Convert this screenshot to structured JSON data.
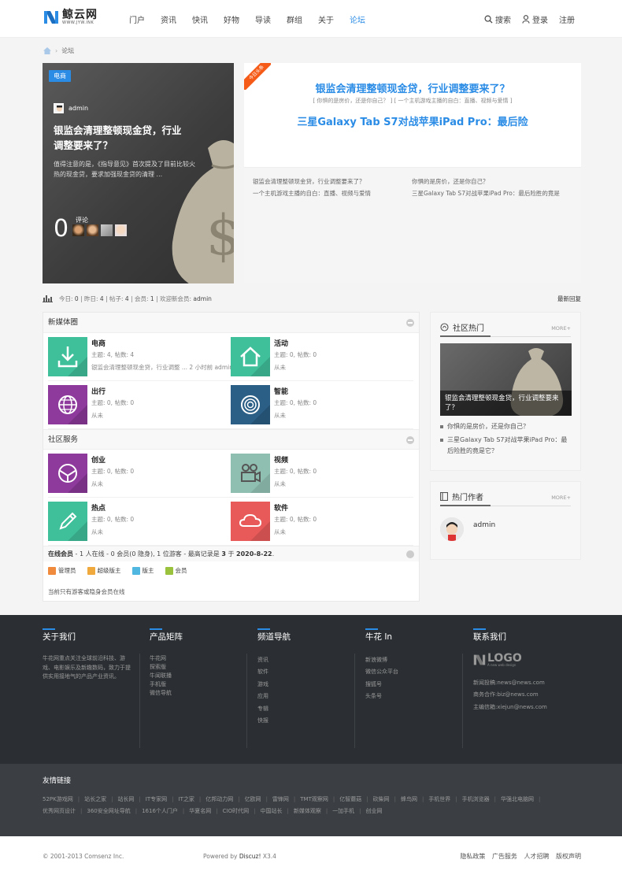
{
  "header": {
    "logo_name": "鲸云网",
    "logo_url": "WWW.JYW.INK",
    "nav": [
      "门户",
      "资讯",
      "快讯",
      "好物",
      "导读",
      "群组",
      "关于",
      "论坛"
    ],
    "active_nav": "论坛",
    "search": "搜索",
    "login": "登录",
    "register": "注册"
  },
  "breadcrumb": {
    "current": "论坛"
  },
  "featured": {
    "tag": "电商",
    "author": "admin",
    "title": "银监会清理整顿现金贷，行业调整要来了？",
    "desc": "值得注意的是，《指导意见》首次提及了目前比较火热的现金贷，要求加强现金贷的清理 ...",
    "comment_label": "评论",
    "comment_count": "0"
  },
  "slides": {
    "ribbon": "今日头条",
    "headline1": "银监会清理整顿现金贷，行业调整要来了？",
    "sub": "[ 你惧的是房价，还是你自己？ ] [ 一个主机游戏主播的自白：直播、视频与爱情 ]",
    "headline2": "三星Galaxy Tab S7对战苹果iPad Pro：最后险",
    "col1": [
      "银监会清理整顿现金贷，行业调整要来了？",
      "一个主机游戏主播的自白：直播、视频与爱情"
    ],
    "col2": [
      "你惧的是房价，还是你自己？",
      "三星Galaxy Tab S7对战苹果iPad Pro：最后险胜的竟是"
    ]
  },
  "stats": {
    "today_label": "今日:",
    "today": "0",
    "yesterday_label": "昨日:",
    "yesterday": "4",
    "posts_label": "帖子:",
    "posts": "4",
    "members_label": "会员:",
    "members": "1",
    "newest_label": "欢迎新会员:",
    "newest": "admin",
    "latest_reply": "最新回复"
  },
  "categories": [
    {
      "name": "新媒体圈",
      "forums": [
        {
          "name": "电商",
          "stats": "主题: 4, 帖数: 4",
          "last": "银监会清理整顿现金贷，行业调整 ... 2 小时前 admin",
          "color": "#3fbf9a",
          "icon": "download-icon"
        },
        {
          "name": "活动",
          "stats": "主题: 0, 帖数: 0",
          "last": "从未",
          "color": "#3fbf9a",
          "icon": "home-icon"
        },
        {
          "name": "出行",
          "stats": "主题: 0, 帖数: 0",
          "last": "从未",
          "color": "#8e3a9d",
          "icon": "globe-icon"
        },
        {
          "name": "智能",
          "stats": "主题: 0, 帖数: 0",
          "last": "从未",
          "color": "#2b5f86",
          "icon": "at-icon"
        }
      ]
    },
    {
      "name": "社区服务",
      "forums": [
        {
          "name": "创业",
          "stats": "主题: 0, 帖数: 0",
          "last": "从未",
          "color": "#8e3a9d",
          "icon": "aperture-icon"
        },
        {
          "name": "视频",
          "stats": "主题: 0, 帖数: 0",
          "last": "从未",
          "color": "#8fbfb0",
          "icon": "video-camera-icon"
        },
        {
          "name": "热点",
          "stats": "主题: 0, 帖数: 0",
          "last": "从未",
          "color": "#3fbf9a",
          "icon": "pencil-icon"
        },
        {
          "name": "软件",
          "stats": "主题: 0, 帖数: 0",
          "last": "从未",
          "color": "#e85a5a",
          "icon": "cloud-icon"
        }
      ]
    }
  ],
  "online": {
    "prefix": "在线会员",
    "text": " - 1 人在线 - 0 会员(0 隐身), 1 位游客 - 最高记录是 ",
    "record": "3",
    "text2": " 于 ",
    "date": "2020-8-22",
    "end": ".",
    "legend": [
      {
        "label": "管理员",
        "color": "#f08a3c"
      },
      {
        "label": "超级版主",
        "color": "#f0a93c"
      },
      {
        "label": "版主",
        "color": "#4fb7e0"
      },
      {
        "label": "会员",
        "color": "#9ac23c"
      }
    ],
    "note": "当前只有游客或隐身会员在线"
  },
  "hot": {
    "title": "社区热门",
    "more": "MORE+",
    "caption": "银监会清理整顿现金贷，行业调整要来了？",
    "items": [
      "你惧的是房价，还是你自己？",
      "三星Galaxy Tab S7对战苹果iPad Pro：最后险胜的竟是它？"
    ]
  },
  "authors": {
    "title": "热门作者",
    "more": "MORE+",
    "name": "admin"
  },
  "footer": {
    "about_title": "关于我们",
    "about_text": "牛花网重点关注全球前沿科技、游戏、电影娱乐及新趣数码，致力于提供实用接地气的产品产业资讯。",
    "matrix_title": "产品矩阵",
    "matrix": [
      "牛花网",
      "探索版",
      "牛闻联播",
      "手机版",
      "微信导航"
    ],
    "channel_title": "频道导航",
    "channel": [
      "资讯",
      "软件",
      "游戏",
      "应用",
      "专辑",
      "快报"
    ],
    "niuhua_title": "牛花 In",
    "niuhua": [
      "新浪微博",
      "微信公众平台",
      "搜狐号",
      "头条号"
    ],
    "contact_title": "联系我们",
    "logo_text": "LOGO",
    "logo_sub": "A new web design",
    "contact": [
      "新闻投稿:news@news.com",
      "商务合作:biz@news.com",
      "主编信箱:xiejun@news.com"
    ]
  },
  "links": {
    "title": "友情链接",
    "items": [
      "52PK游戏网",
      "站长之家",
      "站长网",
      "IT专家网",
      "IT之家",
      "亿邦动力网",
      "亿欧网",
      "雷锋网",
      "TMT观察网",
      "亿智蘑菇",
      "砍柴网",
      "蜂鸟网",
      "手机世界",
      "手机浏览器",
      "华强北电脑网",
      "优秀网页设计",
      "360安全网址导航",
      "1616个人门户",
      "华夏名网",
      "CIO时代网",
      "中国站长",
      "新媒体观察",
      "一加手机",
      "创业网"
    ]
  },
  "copyright": {
    "left": "© 2001-2013 Comsenz Inc.",
    "powered": "Powered by ",
    "product": "Discuz!",
    "version": " X3.4",
    "right": [
      "隐私政策",
      "广告服务",
      "人才招聘",
      "版权声明"
    ]
  }
}
